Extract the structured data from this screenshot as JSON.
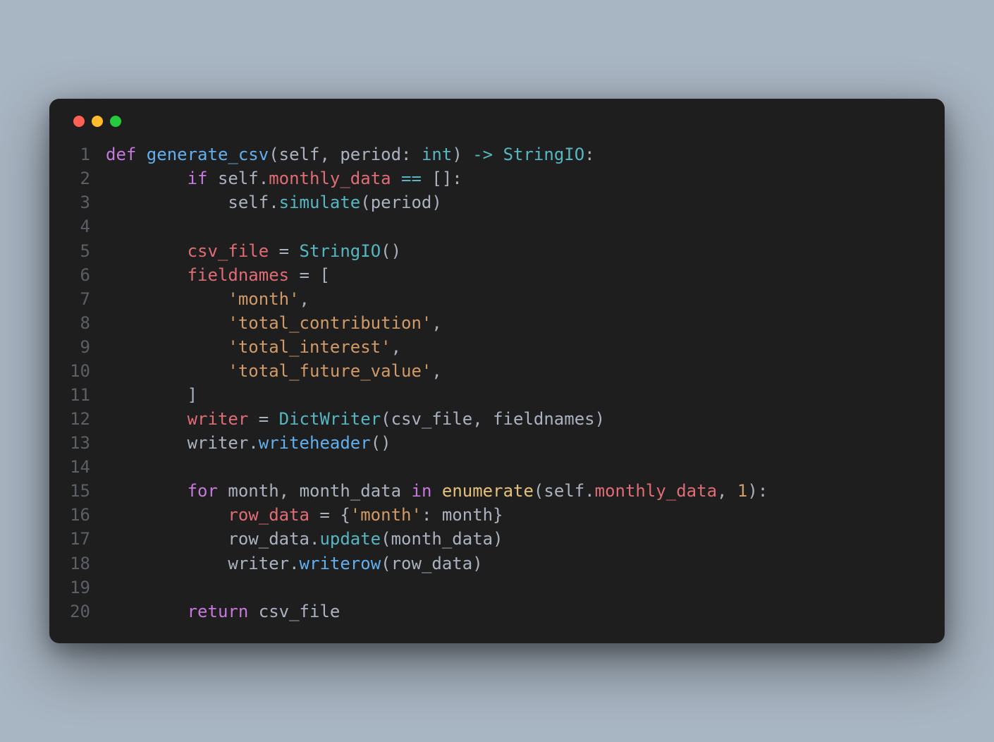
{
  "window": {
    "traffic_lights": [
      "close",
      "minimize",
      "zoom"
    ]
  },
  "code": {
    "lines": [
      {
        "n": "1",
        "tokens": [
          [
            "kw",
            "def "
          ],
          [
            "fn",
            "generate_csv"
          ],
          [
            "punc",
            "("
          ],
          [
            "self",
            "self"
          ],
          [
            "punc",
            ", "
          ],
          [
            "self",
            "period"
          ],
          [
            "punc",
            ": "
          ],
          [
            "type",
            "int"
          ],
          [
            "punc",
            ") "
          ],
          [
            "op",
            "->"
          ],
          [
            "punc",
            " "
          ],
          [
            "type",
            "StringIO"
          ],
          [
            "punc",
            ":"
          ]
        ]
      },
      {
        "n": "2",
        "tokens": [
          [
            "self",
            "        "
          ],
          [
            "kw",
            "if"
          ],
          [
            "self",
            " "
          ],
          [
            "self",
            "self"
          ],
          [
            "punc",
            "."
          ],
          [
            "attr",
            "monthly_data"
          ],
          [
            "punc",
            " "
          ],
          [
            "op",
            "=="
          ],
          [
            "punc",
            " []:"
          ]
        ]
      },
      {
        "n": "3",
        "tokens": [
          [
            "self",
            "            "
          ],
          [
            "self",
            "self"
          ],
          [
            "punc",
            "."
          ],
          [
            "type",
            "simulate"
          ],
          [
            "punc",
            "("
          ],
          [
            "self",
            "period"
          ],
          [
            "punc",
            ")"
          ]
        ]
      },
      {
        "n": "4",
        "tokens": [
          [
            "self",
            ""
          ]
        ]
      },
      {
        "n": "5",
        "tokens": [
          [
            "self",
            "        "
          ],
          [
            "var",
            "csv_file"
          ],
          [
            "punc",
            " = "
          ],
          [
            "type",
            "StringIO"
          ],
          [
            "punc",
            "()"
          ]
        ]
      },
      {
        "n": "6",
        "tokens": [
          [
            "self",
            "        "
          ],
          [
            "var",
            "fieldnames"
          ],
          [
            "punc",
            " = ["
          ]
        ]
      },
      {
        "n": "7",
        "tokens": [
          [
            "self",
            "            "
          ],
          [
            "str",
            "'month'"
          ],
          [
            "punc",
            ","
          ]
        ]
      },
      {
        "n": "8",
        "tokens": [
          [
            "self",
            "            "
          ],
          [
            "str",
            "'total_contribution'"
          ],
          [
            "punc",
            ","
          ]
        ]
      },
      {
        "n": "9",
        "tokens": [
          [
            "self",
            "            "
          ],
          [
            "str",
            "'total_interest'"
          ],
          [
            "punc",
            ","
          ]
        ]
      },
      {
        "n": "10",
        "tokens": [
          [
            "self",
            "            "
          ],
          [
            "str",
            "'total_future_value'"
          ],
          [
            "punc",
            ","
          ]
        ]
      },
      {
        "n": "11",
        "tokens": [
          [
            "self",
            "        "
          ],
          [
            "punc",
            "]"
          ]
        ]
      },
      {
        "n": "12",
        "tokens": [
          [
            "self",
            "        "
          ],
          [
            "var",
            "writer"
          ],
          [
            "punc",
            " = "
          ],
          [
            "type",
            "DictWriter"
          ],
          [
            "punc",
            "("
          ],
          [
            "self",
            "csv_file"
          ],
          [
            "punc",
            ", "
          ],
          [
            "self",
            "fieldnames"
          ],
          [
            "punc",
            ")"
          ]
        ]
      },
      {
        "n": "13",
        "tokens": [
          [
            "self",
            "        "
          ],
          [
            "self",
            "writer"
          ],
          [
            "punc",
            "."
          ],
          [
            "fn",
            "writeheader"
          ],
          [
            "punc",
            "()"
          ]
        ]
      },
      {
        "n": "14",
        "tokens": [
          [
            "self",
            ""
          ]
        ]
      },
      {
        "n": "15",
        "tokens": [
          [
            "self",
            "        "
          ],
          [
            "kw",
            "for"
          ],
          [
            "self",
            " "
          ],
          [
            "self",
            "month"
          ],
          [
            "punc",
            ", "
          ],
          [
            "self",
            "month_data"
          ],
          [
            "self",
            " "
          ],
          [
            "kw",
            "in"
          ],
          [
            "self",
            " "
          ],
          [
            "call",
            "enumerate"
          ],
          [
            "punc",
            "("
          ],
          [
            "self",
            "self"
          ],
          [
            "punc",
            "."
          ],
          [
            "attr",
            "monthly_data"
          ],
          [
            "punc",
            ", "
          ],
          [
            "num",
            "1"
          ],
          [
            "punc",
            "):"
          ]
        ]
      },
      {
        "n": "16",
        "tokens": [
          [
            "self",
            "            "
          ],
          [
            "var",
            "row_data"
          ],
          [
            "punc",
            " = {"
          ],
          [
            "str",
            "'month'"
          ],
          [
            "punc",
            ": "
          ],
          [
            "self",
            "month"
          ],
          [
            "punc",
            "}"
          ]
        ]
      },
      {
        "n": "17",
        "tokens": [
          [
            "self",
            "            "
          ],
          [
            "self",
            "row_data"
          ],
          [
            "punc",
            "."
          ],
          [
            "type",
            "update"
          ],
          [
            "punc",
            "("
          ],
          [
            "self",
            "month_data"
          ],
          [
            "punc",
            ")"
          ]
        ]
      },
      {
        "n": "18",
        "tokens": [
          [
            "self",
            "            "
          ],
          [
            "self",
            "writer"
          ],
          [
            "punc",
            "."
          ],
          [
            "fn",
            "writerow"
          ],
          [
            "punc",
            "("
          ],
          [
            "self",
            "row_data"
          ],
          [
            "punc",
            ")"
          ]
        ]
      },
      {
        "n": "19",
        "tokens": [
          [
            "self",
            ""
          ]
        ]
      },
      {
        "n": "20",
        "tokens": [
          [
            "self",
            "        "
          ],
          [
            "kw",
            "return"
          ],
          [
            "self",
            " "
          ],
          [
            "self",
            "csv_file"
          ]
        ]
      }
    ]
  }
}
